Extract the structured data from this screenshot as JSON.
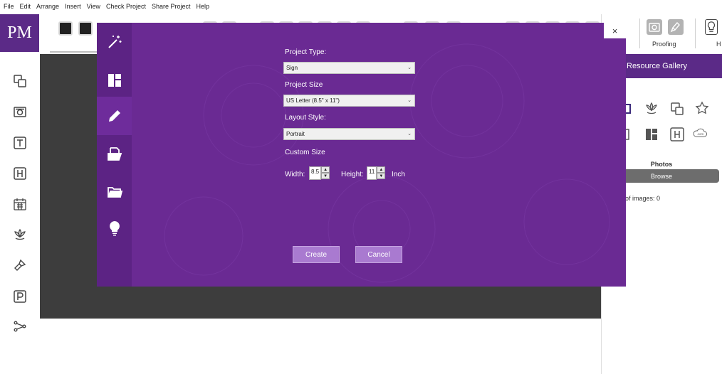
{
  "menu": [
    "File",
    "Edit",
    "Arrange",
    "Insert",
    "View",
    "Check Project",
    "Share Project",
    "Help"
  ],
  "logo": "PM",
  "left_rail": [
    "copy-shapes-icon",
    "camera-icon",
    "text-t-icon",
    "heading-h-icon",
    "calendar-icon",
    "lotus-icon",
    "paintbrush-icon",
    "parking-p-icon",
    "share-icon"
  ],
  "right_panel": {
    "proofing_label": "Proofing",
    "h_label": "H",
    "gallery_title": "Resource Gallery",
    "photos_label": "Photos",
    "browse_label": "Browse",
    "images_count": "of images: 0"
  },
  "dialog": {
    "close_glyph": "×",
    "sidebar": [
      "magic-wand-icon",
      "layout-icon",
      "pencil-icon",
      "open-file-icon",
      "folder-icon",
      "lightbulb-icon"
    ],
    "project_type_label": "Project Type:",
    "project_type_value": "Sign",
    "project_size_label": "Project Size",
    "project_size_value": "US Letter (8.5\" x 11\")",
    "layout_style_label": "Layout Style:",
    "layout_style_value": "Portrait",
    "custom_size_label": "Custom Size",
    "width_label": "Width:",
    "width_value": "8.5",
    "height_label": "Height:",
    "height_value": "11",
    "unit_label": "Inch",
    "create_label": "Create",
    "cancel_label": "Cancel"
  },
  "colors": {
    "brand_purple": "#5b2a87",
    "dialog_purple": "#6a2a93",
    "button_purple": "#a97ad0"
  }
}
